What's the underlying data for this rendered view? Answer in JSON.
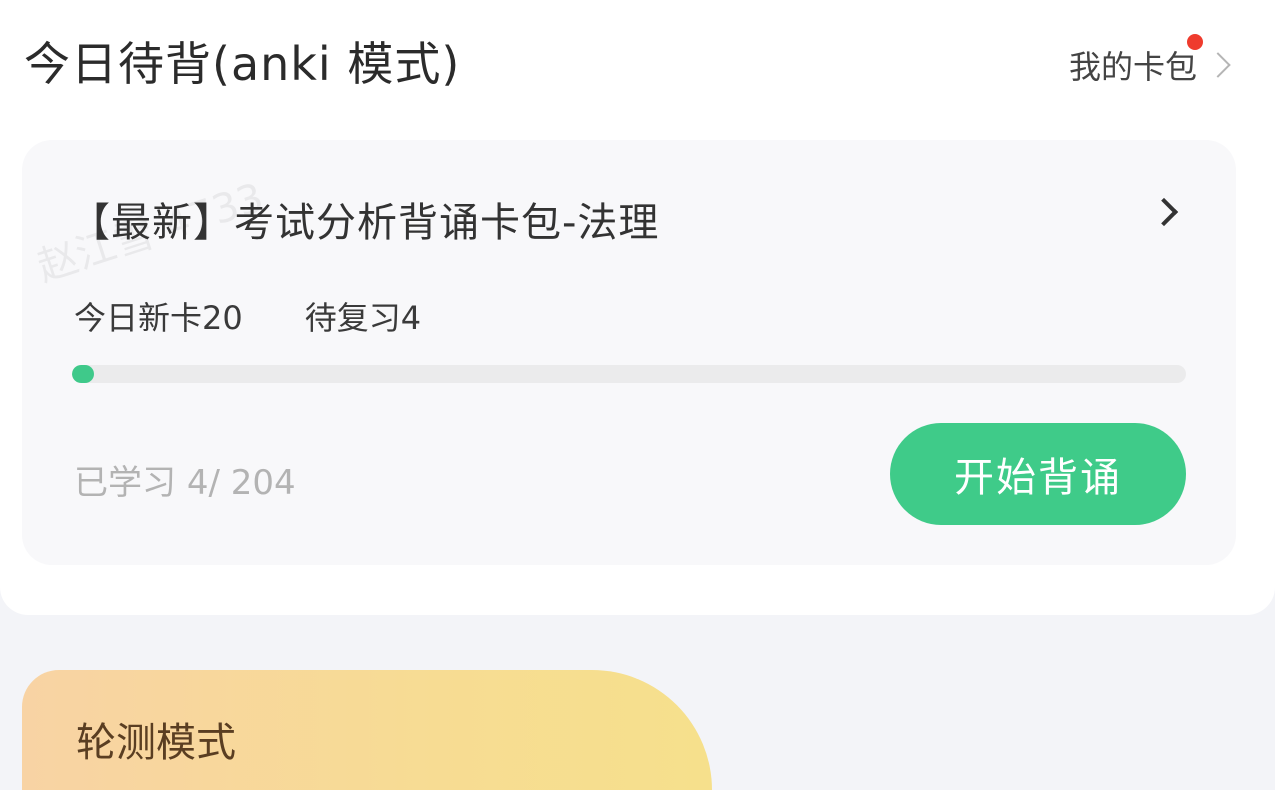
{
  "header": {
    "title": "今日待背(anki 模式)",
    "my_deck_label": "我的卡包",
    "has_notification": true
  },
  "deck": {
    "title": "【最新】考试分析背诵卡包-法理",
    "watermark": "赵江雪 4733",
    "new_today_label": "今日新卡",
    "new_today_count": "20",
    "review_label": "待复习",
    "review_count": "4",
    "learned_label": "已学习",
    "learned_text": "4/ 204",
    "learned_value": 4,
    "total_value": 204,
    "progress_fraction": 0.02,
    "start_button_label": "开始背诵"
  },
  "bottom_card": {
    "title": "轮测模式"
  },
  "colors": {
    "accent_green": "#3fcb89",
    "notification_red": "#ef3b2d",
    "background": "#f3f4f8"
  }
}
